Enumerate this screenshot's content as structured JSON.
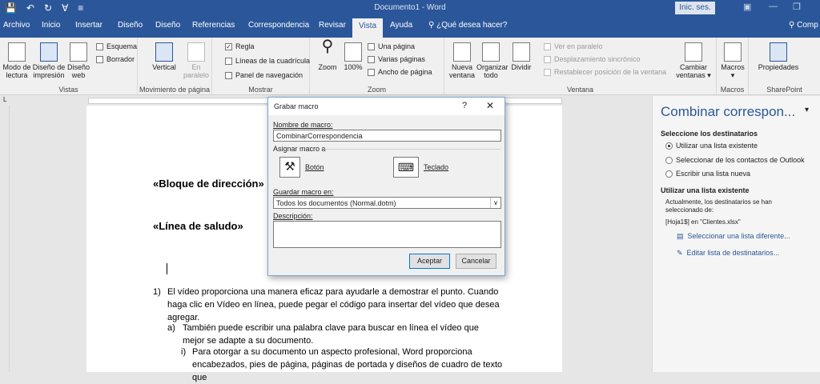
{
  "titlebar": {
    "doc_title": "Documento1 - Word",
    "login": "Inic. ses."
  },
  "tabs": [
    "Archivo",
    "Inicio",
    "Insertar",
    "Diseño",
    "Diseño",
    "Referencias",
    "Correspondencia",
    "Revisar",
    "Vista",
    "Ayuda",
    "¿Qué desea hacer?",
    "Comp"
  ],
  "ribbon": {
    "vistas": {
      "label": "Vistas",
      "modo": "Modo de lectura",
      "diseno_impresion": "Diseño de impresión",
      "diseno_web": "Diseño web",
      "esquema": "Esquema",
      "borrador": "Borrador"
    },
    "movimiento": {
      "label": "Movimiento de página",
      "vertical": "Vertical",
      "en_paralelo": "En paralelo"
    },
    "mostrar": {
      "label": "Mostrar",
      "regla": "Regla",
      "lineas": "Líneas de la cuadrícula",
      "panel": "Panel de navegación"
    },
    "zoom": {
      "label": "Zoom",
      "zoom": "Zoom",
      "pct": "100%",
      "una_pagina": "Una página",
      "varias": "Varias páginas",
      "ancho": "Ancho de página"
    },
    "ventana": {
      "label": "Ventana",
      "nueva": "Nueva ventana",
      "organizar": "Organizar todo",
      "dividir": "Dividir",
      "ver_paralelo": "Ver en paralelo",
      "desplazamiento": "Desplazamiento sincrónico",
      "restablecer": "Restablecer posición de la ventana",
      "cambiar": "Cambiar ventanas"
    },
    "macros": {
      "label": "Macros",
      "macros": "Macros"
    },
    "sharepoint": {
      "label": "SharePoint",
      "propiedades": "Propiedades"
    }
  },
  "document": {
    "bloque": "«Bloque de dirección»",
    "saludo": "«Línea de saludo»",
    "p1_num": "1)",
    "p1": "El vídeo proporciona una manera eficaz para ayudarle a demostrar el punto. Cuando haga clic en Vídeo en línea, puede pegar el código para insertar del vídeo que desea agregar.",
    "pa_num": "a)",
    "pa": "También puede escribir una palabra clave para buscar en línea el vídeo que mejor se adapte a su documento.",
    "pi_num": "i)",
    "pi": "Para otorgar a su documento un aspecto profesional, Word proporciona encabezados, pies de página, páginas de portada y diseños de cuadro de texto que"
  },
  "dialog": {
    "title": "Grabar macro",
    "help": "?",
    "close": "✕",
    "nombre_label": "Nombre de macro:",
    "nombre_value": "CombinarCorrespondencia",
    "asignar_label": "Asignar macro a",
    "boton": "Botón",
    "teclado": "Teclado",
    "guardar_label": "Guardar macro en:",
    "guardar_value": "Todos los documentos (Normal.dotm)",
    "descripcion_label": "Descripción:",
    "aceptar": "Aceptar",
    "cancelar": "Cancelar"
  },
  "pane": {
    "title": "Combinar correspon...",
    "sel_heading": "Seleccione los destinatarios",
    "options": [
      "Utilizar una lista existente",
      "Seleccionar de los contactos de Outlook",
      "Escribir una lista nueva"
    ],
    "util_heading": "Utilizar una lista existente",
    "actual": "Actualmente, los destinatarios se han seleccionado de:",
    "source": "[Hoja1$] en \"Clientes.xlsx\"",
    "link1": "Seleccionar una lista diferente...",
    "link2": "Editar lista de destinatarios..."
  },
  "colors": {
    "accent": "#2b579a"
  }
}
